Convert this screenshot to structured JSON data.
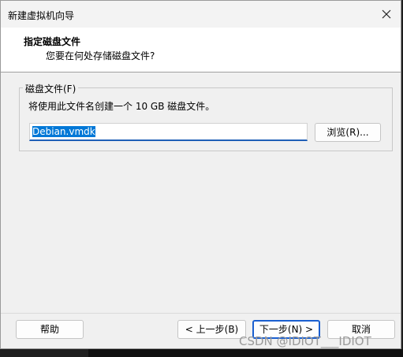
{
  "window": {
    "title": "新建虚拟机向导",
    "close_icon": "close-icon"
  },
  "header": {
    "title": "指定磁盘文件",
    "subtitle": "您要在何处存储磁盘文件?"
  },
  "disk_group": {
    "label": "磁盘文件(F)",
    "info": "将使用此文件名创建一个 10 GB 磁盘文件。",
    "file_value": "Debian.vmdk",
    "browse_label": "浏览(R)..."
  },
  "footer": {
    "help_label": "帮助",
    "back_label": "< 上一步(B)",
    "next_label": "下一步(N) >",
    "cancel_label": "取消"
  },
  "watermark": {
    "text": "CSDN @IDIOT___IDIOT"
  },
  "colors": {
    "accent": "#1a5fd0",
    "selection": "#0078d7"
  }
}
